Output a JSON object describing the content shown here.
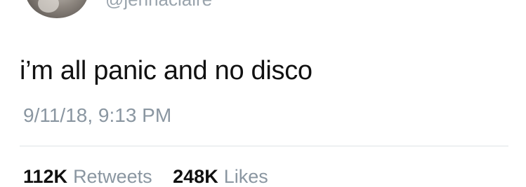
{
  "profile": {
    "handle": "@jennaclaire"
  },
  "tweet": {
    "text": "i’m all panic and no disco",
    "timestamp": "9/11/18, 9:13 PM"
  },
  "stats": {
    "retweets_count": "112K",
    "retweets_label": "Retweets",
    "likes_count": "248K",
    "likes_label": "Likes"
  }
}
